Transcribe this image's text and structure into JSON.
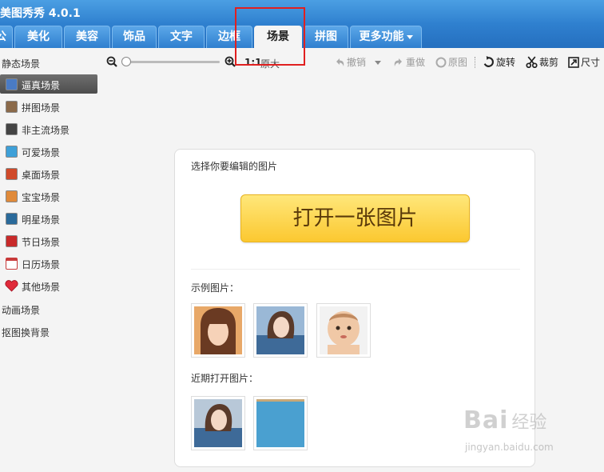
{
  "app": {
    "title": "美图秀秀 4.0.1"
  },
  "tabs": [
    {
      "label": "公",
      "active": false
    },
    {
      "label": "美化",
      "active": false
    },
    {
      "label": "美容",
      "active": false
    },
    {
      "label": "饰品",
      "active": false
    },
    {
      "label": "文字",
      "active": false
    },
    {
      "label": "边框",
      "active": false
    },
    {
      "label": "场景",
      "active": true
    },
    {
      "label": "拼图",
      "active": false
    },
    {
      "label": "更多功能",
      "active": false
    }
  ],
  "toolbar": {
    "zoom_one_one": "1:1",
    "original_size": "原大",
    "undo": "撤销",
    "redo": "重做",
    "original": "原图",
    "rotate": "旋转",
    "crop": "裁剪",
    "size": "尺寸",
    "zoom_level": 0.0
  },
  "sidebar": {
    "static_heading": "静态场景",
    "items": [
      {
        "label": "逼真场景",
        "active": true,
        "icon": "realistic-scene-icon",
        "color": "#4a7bc4"
      },
      {
        "label": "拼图场景",
        "active": false,
        "icon": "puzzle-scene-icon",
        "color": "#8b6a4a"
      },
      {
        "label": "非主流场景",
        "active": false,
        "icon": "alternative-scene-icon",
        "color": "#444444"
      },
      {
        "label": "可爱场景",
        "active": false,
        "icon": "cute-scene-icon",
        "color": "#3ea0d8"
      },
      {
        "label": "桌面场景",
        "active": false,
        "icon": "desktop-scene-icon",
        "color": "#d04a2a"
      },
      {
        "label": "宝宝场景",
        "active": false,
        "icon": "baby-scene-icon",
        "color": "#e08a3a"
      },
      {
        "label": "明星场景",
        "active": false,
        "icon": "star-scene-icon",
        "color": "#2a6a9a"
      },
      {
        "label": "节日场景",
        "active": false,
        "icon": "holiday-scene-icon",
        "color": "#c82a2a"
      },
      {
        "label": "日历场景",
        "active": false,
        "icon": "calendar-scene-icon",
        "color": "#c83a3a"
      },
      {
        "label": "其他场景",
        "active": false,
        "icon": "heart-icon",
        "color": "#e02a3a"
      }
    ],
    "animated_heading": "动画场景",
    "cutout_heading": "抠图换背景"
  },
  "main": {
    "prompt": "选择你要编辑的图片",
    "open_button": "打开一张图片",
    "examples_label": "示例图片：",
    "recent_label": "近期打开图片："
  },
  "watermark": {
    "big": "Bai",
    "cn": "经验",
    "small": "jingyan.baidu.com"
  },
  "colors": {
    "title_blue": "#2f80cf",
    "highlight_red": "#e02020",
    "button_yellow": "#fbc830"
  }
}
